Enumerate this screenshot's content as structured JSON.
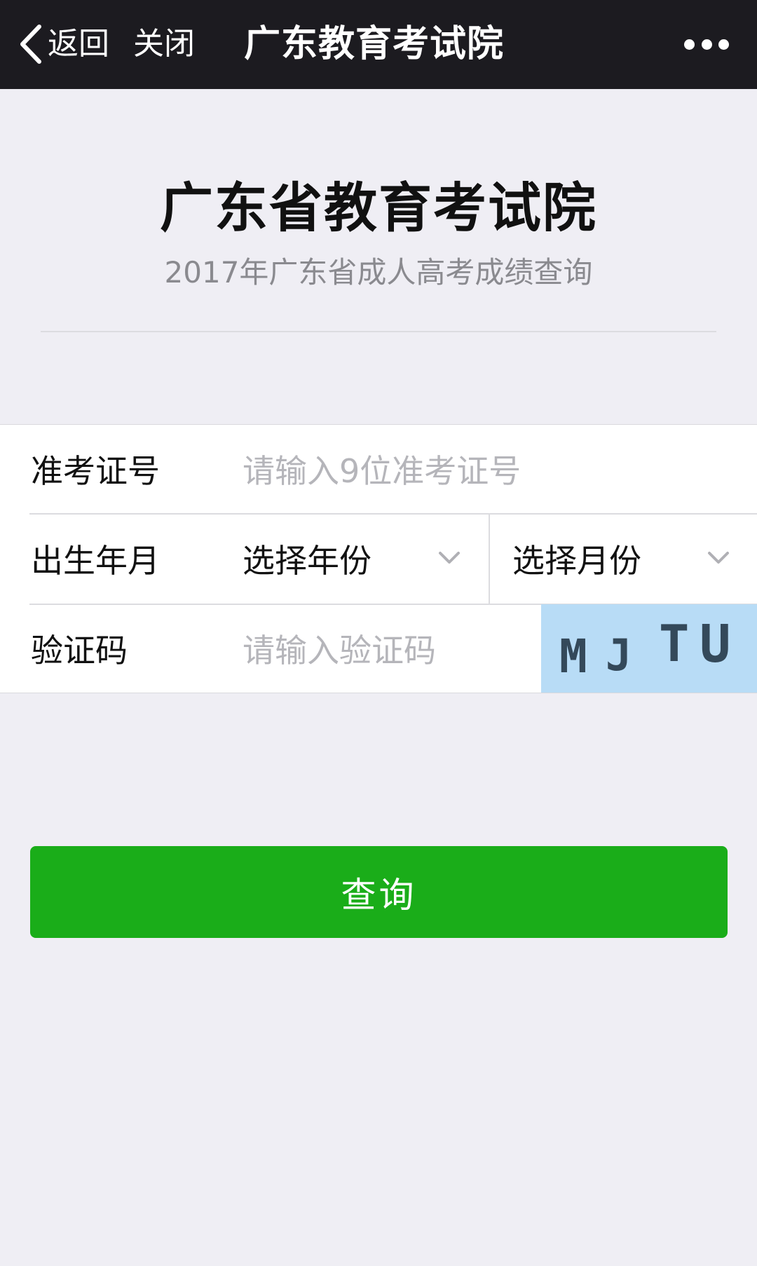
{
  "navbar": {
    "back_label": "返回",
    "close_label": "关闭",
    "title": "广东教育考试院",
    "back_icon": "chevron-left-icon",
    "more_icon": "more-dots-icon"
  },
  "header": {
    "title": "广东省教育考试院",
    "subtitle": "2017年广东省成人高考成绩查询"
  },
  "form": {
    "exam_id": {
      "label": "准考证号",
      "placeholder": "请输入9位准考证号"
    },
    "birth": {
      "label": "出生年月",
      "year_select": "选择年份",
      "month_select": "选择月份"
    },
    "captcha": {
      "label": "验证码",
      "placeholder": "请输入验证码",
      "chars": [
        "M",
        "J",
        "T",
        "U"
      ]
    }
  },
  "submit_label": "查询",
  "colors": {
    "navbar_bg": "#1c1b20",
    "page_bg": "#efeef4",
    "primary_green": "#1aad19",
    "captcha_bg": "#b8dcf6",
    "placeholder_text": "#b5b5ba"
  }
}
